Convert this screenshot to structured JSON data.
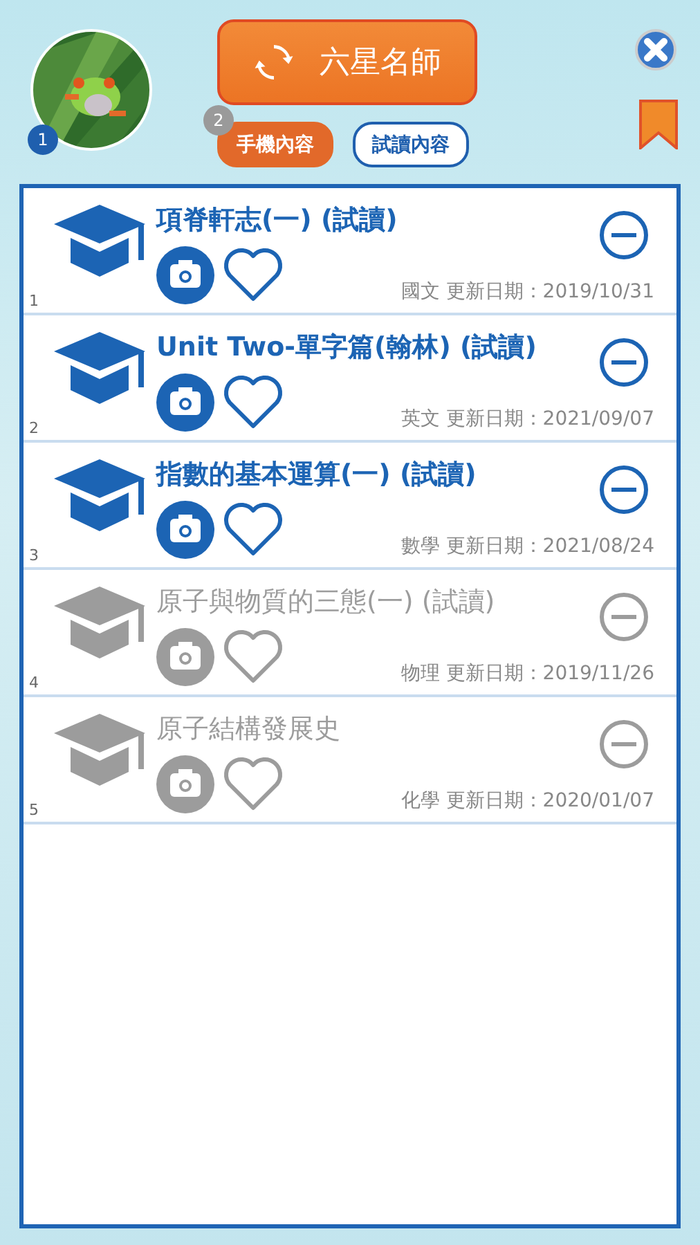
{
  "header": {
    "avatar_badge": "1",
    "title_button": "六星名師",
    "tab_badge": "2",
    "tabs": [
      {
        "label": "手機內容",
        "selected": true
      },
      {
        "label": "試讀內容",
        "selected": false
      }
    ]
  },
  "items": [
    {
      "index": "1",
      "title": "項脊軒志(一) (試讀)",
      "meta": "國文 更新日期：2019/10/31",
      "disabled": false
    },
    {
      "index": "2",
      "title": "Unit Two-單字篇(翰林) (試讀)",
      "meta": "英文 更新日期：2021/09/07",
      "disabled": false
    },
    {
      "index": "3",
      "title": "指數的基本運算(一) (試讀)",
      "meta": "數學 更新日期：2021/08/24",
      "disabled": false
    },
    {
      "index": "4",
      "title": "原子與物質的三態(一) (試讀)",
      "meta": "物理 更新日期：2019/11/26",
      "disabled": true
    },
    {
      "index": "5",
      "title": "原子結構發展史",
      "meta": "化學 更新日期：2020/01/07",
      "disabled": true
    }
  ]
}
